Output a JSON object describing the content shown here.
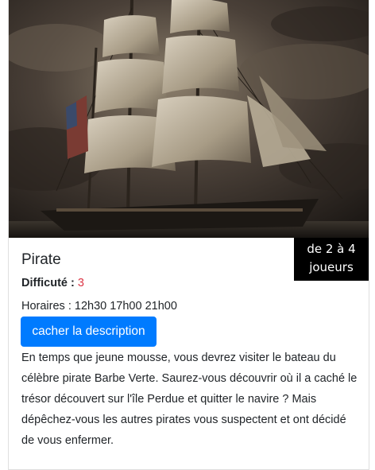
{
  "card": {
    "image_alt": "ship-image",
    "players_line1": "de 2 à 4",
    "players_line2": "joueurs",
    "title": "Pirate",
    "difficulty_label": "Difficuté :",
    "difficulty_value": "3",
    "schedule": "Horaires : 12h30 17h00 21h00",
    "toggle_label": "cacher la description",
    "description": "En temps que jeune mousse, vous devrez visiter le bateau du célèbre pirate Barbe Verte. Saurez-vous découvrir où il a caché le trésor découvert sur l'île Perdue et quitter le navire ? Mais dépêchez-vous les autres pirates vous suspectent et ont décidé de vous enfermer."
  },
  "colors": {
    "primary": "#007bff",
    "difficulty": "#dc3545",
    "badge_bg": "#000000"
  }
}
